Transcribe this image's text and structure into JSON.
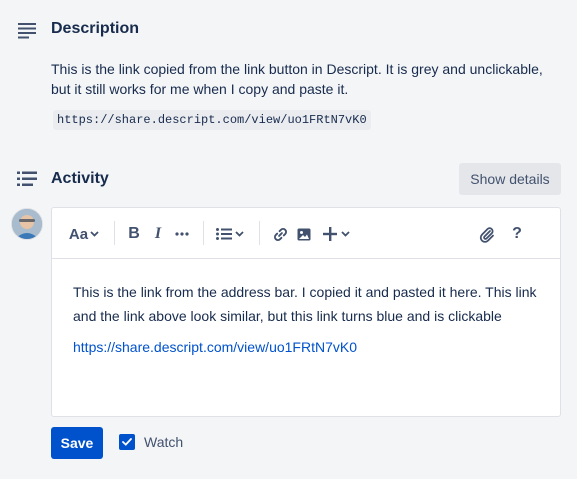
{
  "description": {
    "title": "Description",
    "text": "This is the link copied from the link button in Descript. It is grey and unclickable, but it still works for me when I copy and paste it.",
    "code_link": "https://share.descript.com/view/uo1FRtN7vK0"
  },
  "activity": {
    "title": "Activity",
    "show_details_label": "Show details"
  },
  "editor": {
    "toolbar": {
      "text_style_label": "Aa",
      "icons": [
        "text-style-icon",
        "bold-icon",
        "italic-icon",
        "more-formatting-icon",
        "bullet-list-icon",
        "link-icon",
        "image-icon",
        "insert-plus-icon",
        "attachment-icon",
        "help-icon"
      ]
    },
    "body_text": "This is the link from the address bar. I copied it and pasted it here. This link and the link above look similar, but this link turns blue and is clickable",
    "link_text": "https://share.descript.com/view/uo1FRtN7vK0"
  },
  "actions": {
    "save_label": "Save",
    "watch_label": "Watch",
    "watch_checked": true
  },
  "colors": {
    "primary": "#0052cc",
    "text": "#172b4d",
    "subtle_text": "#42526e",
    "background": "#f4f5f7",
    "link": "#0052cc"
  }
}
